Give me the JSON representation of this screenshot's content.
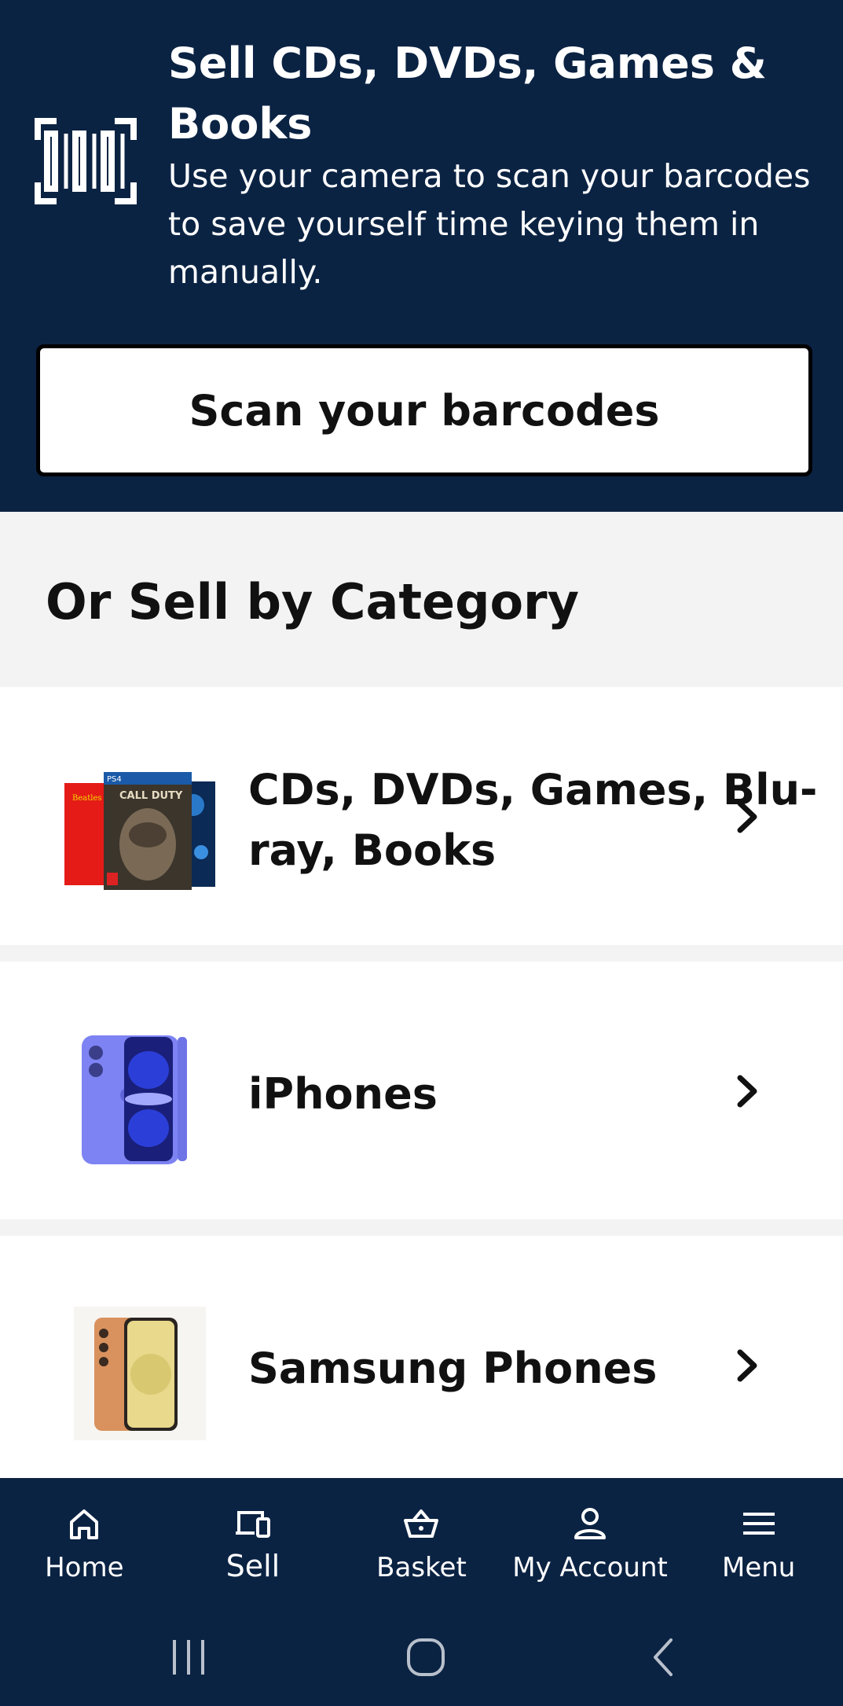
{
  "hero": {
    "title": "Sell CDs, DVDs, Games & Books",
    "description": "Use your camera to scan your barcodes to save yourself time keying them in manually.",
    "icon": "barcode-scan-icon",
    "scan_button_label": "Scan your barcodes"
  },
  "categories_section": {
    "title": "Or Sell by Category",
    "items": [
      {
        "label": "CDs, DVDs, Games, Blu-ray, Books",
        "icon": "media-collage-image"
      },
      {
        "label": "iPhones",
        "icon": "iphone-image"
      },
      {
        "label": "Samsung Phones",
        "icon": "samsung-phone-image"
      }
    ]
  },
  "bottom_nav": {
    "items": [
      {
        "label": "Home",
        "icon": "home-icon"
      },
      {
        "label": "Sell",
        "icon": "devices-icon",
        "active": true
      },
      {
        "label": "Basket",
        "icon": "basket-icon"
      },
      {
        "label": "My Account",
        "icon": "account-icon"
      },
      {
        "label": "Menu",
        "icon": "hamburger-menu-icon"
      }
    ]
  },
  "system_nav": {
    "buttons": [
      "recent-apps-icon",
      "home-circle-icon",
      "back-chevron-icon"
    ]
  },
  "colors": {
    "brand_navy": "#0b2343",
    "background_gray": "#f3f3f3",
    "card_white": "#ffffff"
  }
}
